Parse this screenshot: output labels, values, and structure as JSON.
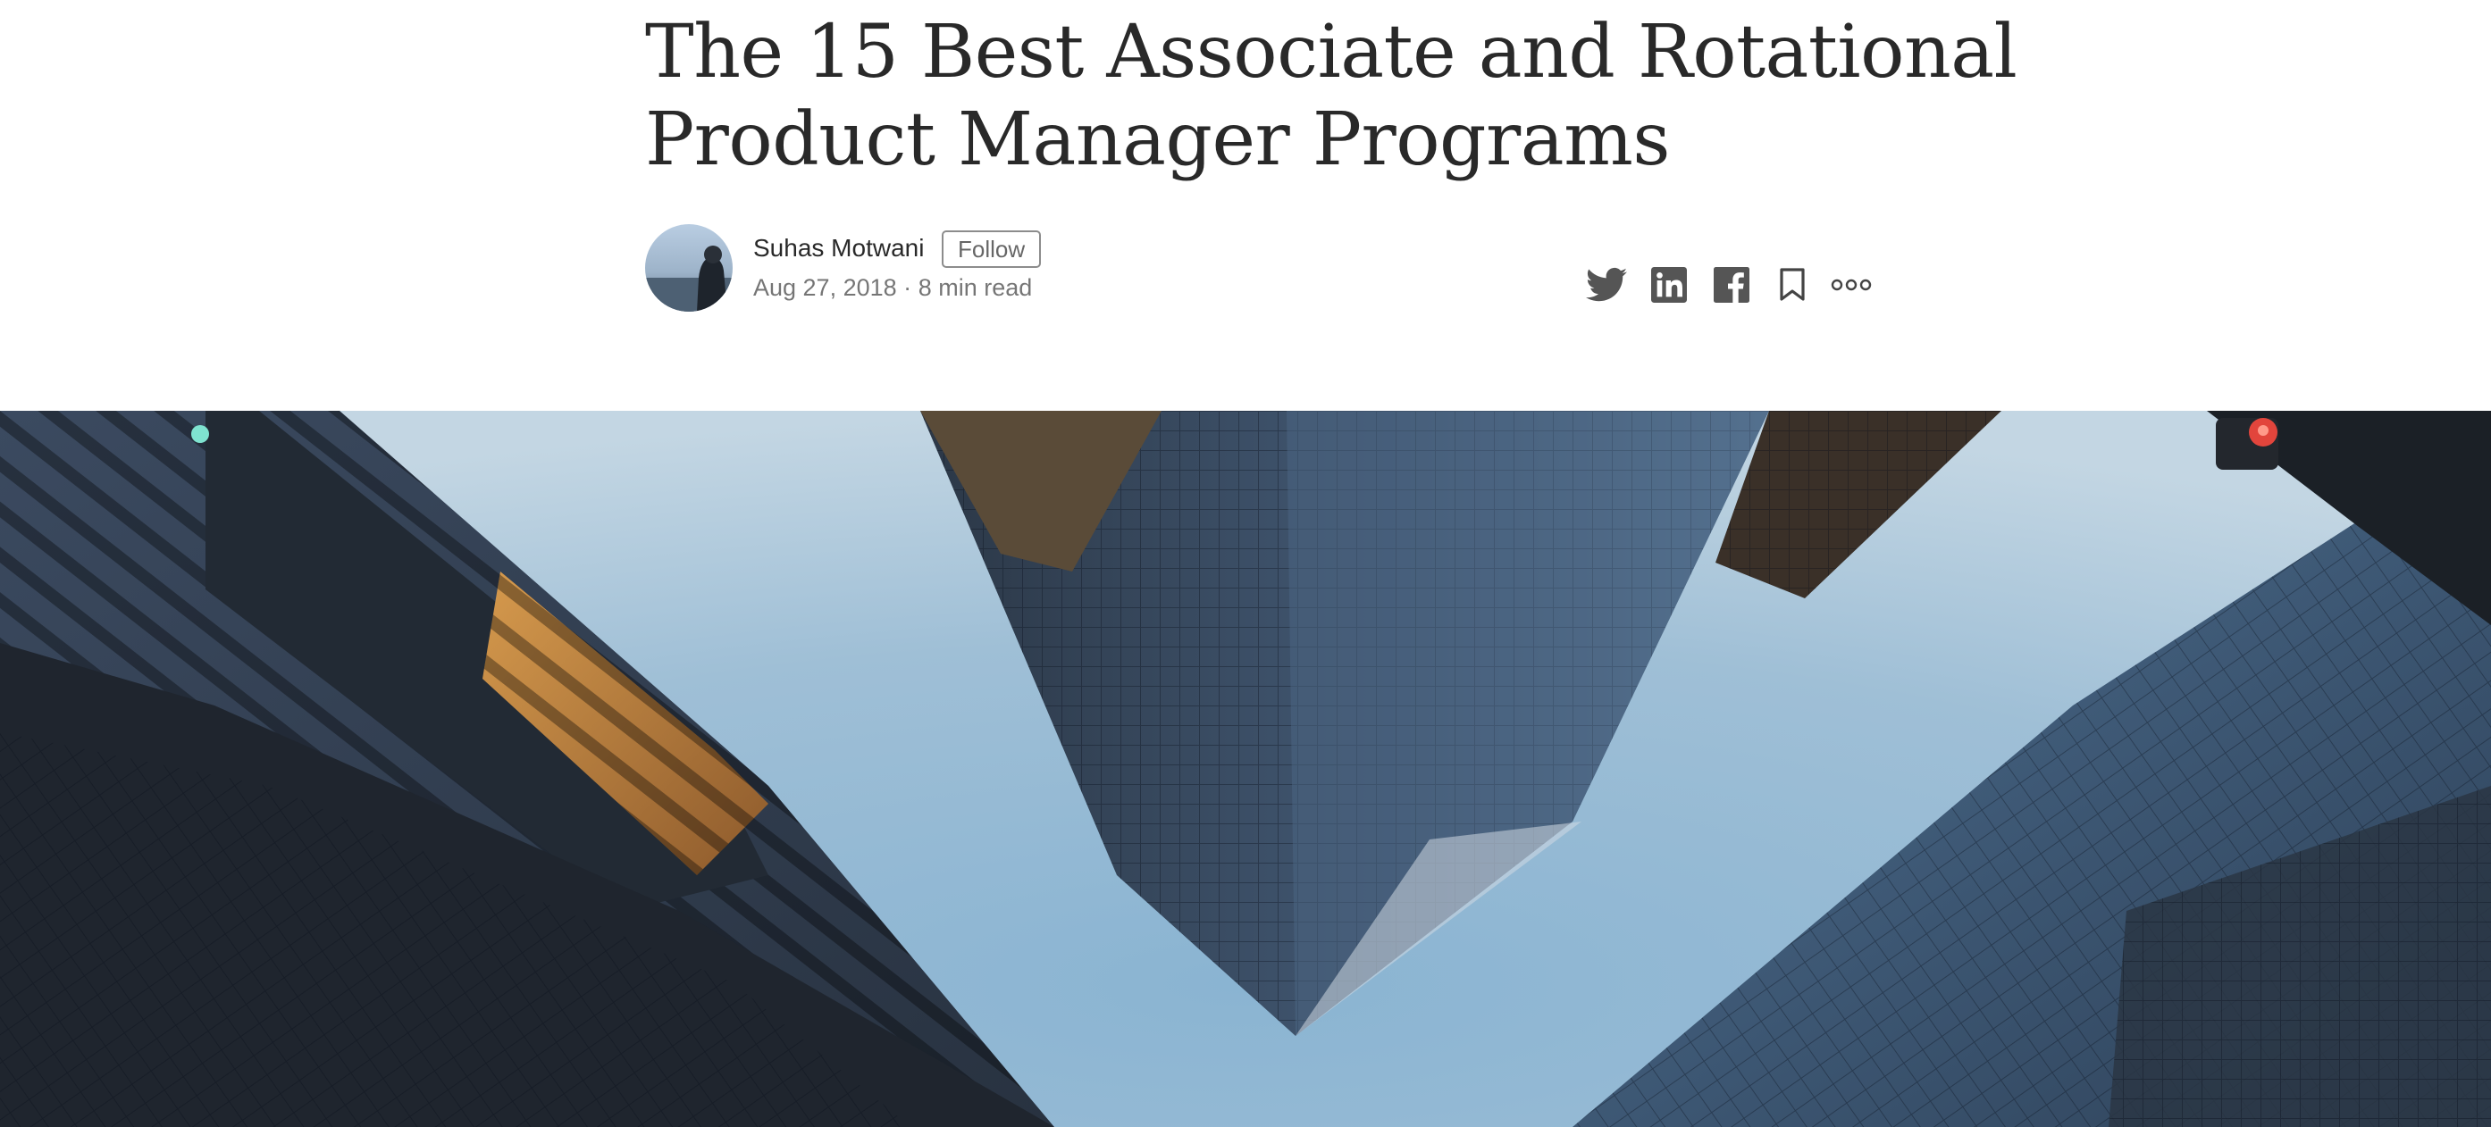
{
  "article": {
    "title": "The 15 Best Associate and Rotational Product Manager Programs",
    "author": {
      "name": "Suhas Motwani",
      "follow_label": "Follow",
      "avatar_icon": "avatar-photo"
    },
    "date": "Aug 27, 2018",
    "separator": "·",
    "read_time": "8 min read"
  },
  "share": {
    "icons": [
      "twitter-icon",
      "linkedin-icon",
      "facebook-icon",
      "bookmark-icon",
      "more-icon"
    ],
    "icon_color": "#555555"
  },
  "hero_image": {
    "subject": "upward view of glass skyscrapers against a blue sky",
    "sky_color": "#8fb6d3",
    "building_color": "#2f3540"
  }
}
